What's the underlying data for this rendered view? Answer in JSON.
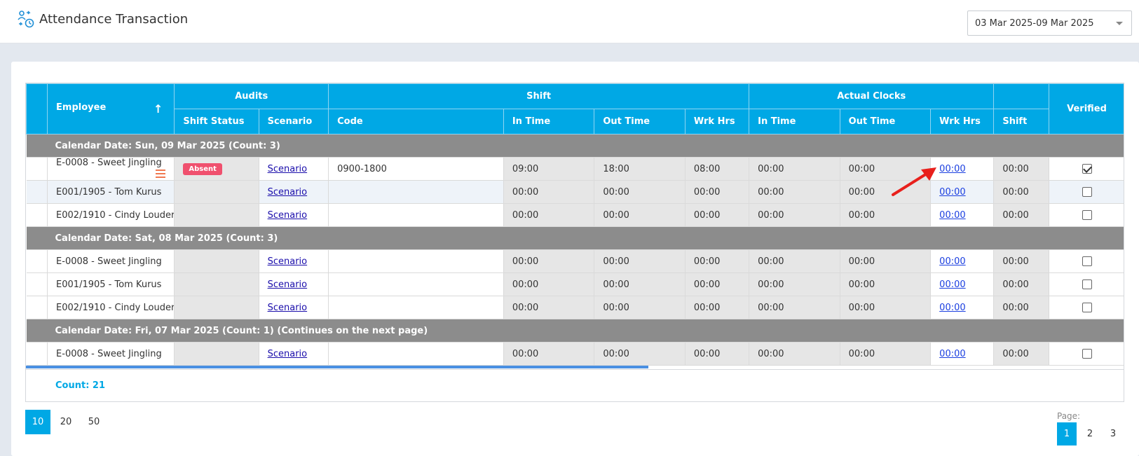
{
  "header": {
    "title": "Attendance Transaction",
    "date_range": "03 Mar 2025-09 Mar 2025"
  },
  "grid": {
    "headers": {
      "employee": "Employee",
      "audits": "Audits",
      "shift": "Shift",
      "actual_clocks": "Actual Clocks",
      "verified": "Verified",
      "shift_status": "Shift Status",
      "scenario": "Scenario",
      "code": "Code",
      "in_time": "In Time",
      "out_time": "Out Time",
      "wrk_hrs": "Wrk Hrs",
      "ac_in_time": "In Time",
      "ac_out_time": "Out Time",
      "ac_wrk_hrs": "Wrk Hrs",
      "ac_shift": "Shift"
    },
    "groups": [
      {
        "label": "Calendar Date: Sun, 09 Mar 2025 (Count: 3)",
        "rows": [
          {
            "employee": "E-0008 - Sweet Jingling",
            "status": "Absent",
            "scenario": "Scenario",
            "code": "0900-1800",
            "in": "09:00",
            "out": "18:00",
            "wrk": "08:00",
            "ac_in": "00:00",
            "ac_out": "00:00",
            "ac_wrk": "00:00",
            "ac_shift": "00:00",
            "verified": true
          },
          {
            "employee": "E001/1905 - Tom Kurus",
            "status": "",
            "scenario": "Scenario",
            "code": "",
            "in": "00:00",
            "out": "00:00",
            "wrk": "00:00",
            "ac_in": "00:00",
            "ac_out": "00:00",
            "ac_wrk": "00:00",
            "ac_shift": "00:00",
            "verified": false
          },
          {
            "employee": "E002/1910 - Cindy Louder",
            "status": "",
            "scenario": "Scenario",
            "code": "",
            "in": "00:00",
            "out": "00:00",
            "wrk": "00:00",
            "ac_in": "00:00",
            "ac_out": "00:00",
            "ac_wrk": "00:00",
            "ac_shift": "00:00",
            "verified": false
          }
        ]
      },
      {
        "label": "Calendar Date: Sat, 08 Mar 2025 (Count: 3)",
        "rows": [
          {
            "employee": "E-0008 - Sweet Jingling",
            "status": "",
            "scenario": "Scenario",
            "code": "",
            "in": "00:00",
            "out": "00:00",
            "wrk": "00:00",
            "ac_in": "00:00",
            "ac_out": "00:00",
            "ac_wrk": "00:00",
            "ac_shift": "00:00",
            "verified": false
          },
          {
            "employee": "E001/1905 - Tom Kurus",
            "status": "",
            "scenario": "Scenario",
            "code": "",
            "in": "00:00",
            "out": "00:00",
            "wrk": "00:00",
            "ac_in": "00:00",
            "ac_out": "00:00",
            "ac_wrk": "00:00",
            "ac_shift": "00:00",
            "verified": false
          },
          {
            "employee": "E002/1910 - Cindy Louder",
            "status": "",
            "scenario": "Scenario",
            "code": "",
            "in": "00:00",
            "out": "00:00",
            "wrk": "00:00",
            "ac_in": "00:00",
            "ac_out": "00:00",
            "ac_wrk": "00:00",
            "ac_shift": "00:00",
            "verified": false
          }
        ]
      },
      {
        "label": "Calendar Date: Fri, 07 Mar 2025 (Count: 1) (Continues on the next page)",
        "rows": [
          {
            "employee": "E-0008 - Sweet Jingling",
            "status": "",
            "scenario": "Scenario",
            "code": "",
            "in": "00:00",
            "out": "00:00",
            "wrk": "00:00",
            "ac_in": "00:00",
            "ac_out": "00:00",
            "ac_wrk": "00:00",
            "ac_shift": "00:00",
            "verified": false
          }
        ]
      }
    ],
    "count": "Count: 21"
  },
  "pager": {
    "sizes": [
      "10",
      "20",
      "50"
    ],
    "active_size": "10",
    "page_label": "Page:",
    "pages": [
      "1",
      "2",
      "3"
    ],
    "active_page": "1"
  },
  "colors": {
    "header_blue": "#00a8e5",
    "group_gray": "#8c8c8c",
    "absent_badge": "#f0506e",
    "annotation_arrow": "#e8201c"
  },
  "icons": {
    "app": "attendance-icon",
    "row_menu": "hamburger-menu-icon",
    "dropdown": "chevron-down-icon",
    "sort": "sort-arrow-up-icon",
    "annotation": "red-arrow-pointer"
  }
}
